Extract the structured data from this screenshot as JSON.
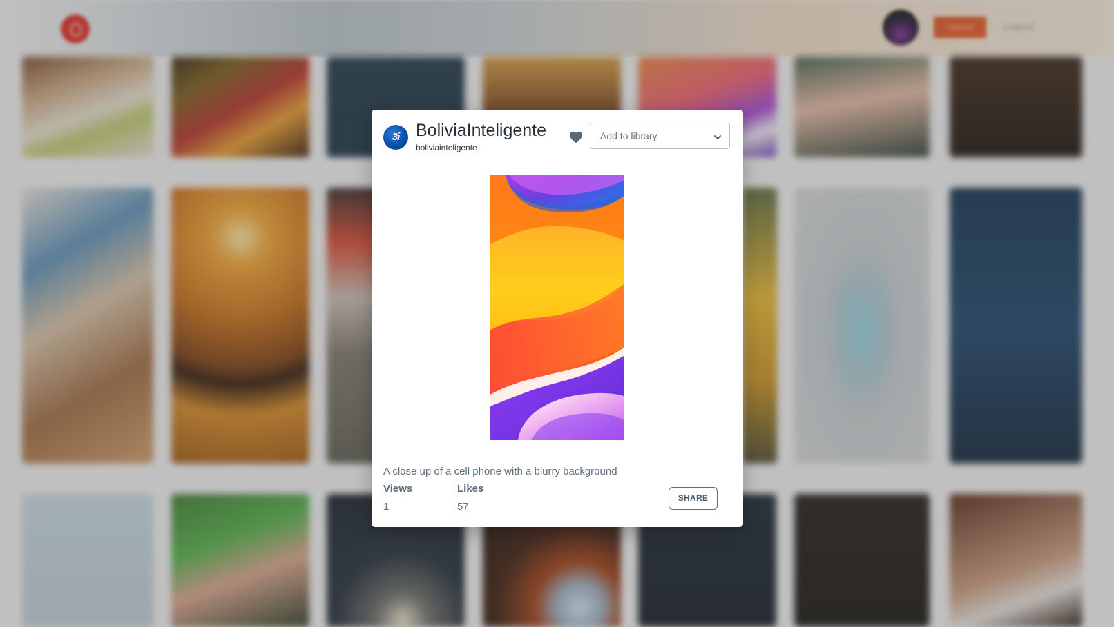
{
  "header": {
    "logo_icon": "pinterest-style-logo-icon",
    "upload_label": "Upload",
    "logout_label": "Logout"
  },
  "modal": {
    "author": {
      "avatar_text": "3i",
      "name": "BoliviaInteligente",
      "handle": "boliviainteligente"
    },
    "like_icon": "heart-icon",
    "library_select": {
      "selected": "Add to library",
      "icon": "chevron-down-icon"
    },
    "caption": "A close up of a cell phone with a blurry background",
    "stats": {
      "views_label": "Views",
      "views_value": "1",
      "likes_label": "Likes",
      "likes_value": "57"
    },
    "share_label": "SHARE"
  },
  "colors": {
    "brand_red": "#e12a1f",
    "cta_orange": "#e4541f",
    "text_gray": "#5f6e7d",
    "heart": "#5a6876"
  }
}
